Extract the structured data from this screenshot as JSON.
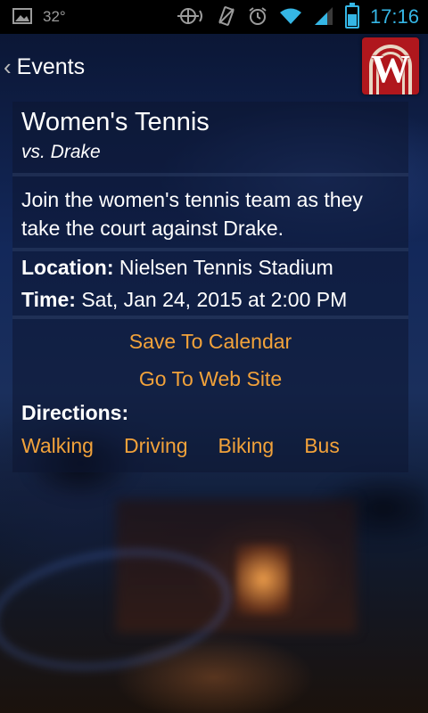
{
  "status_bar": {
    "temperature": "32°",
    "time": "17:16"
  },
  "action_bar": {
    "back_title": "Events",
    "logo_letter": "W"
  },
  "event": {
    "title": "Women's Tennis",
    "opponent": "vs. Drake",
    "description": "Join the women's tennis team as they take the court against Drake.",
    "location_label": "Location:",
    "location_value": "Nielsen Tennis Stadium",
    "time_label": "Time:",
    "time_value": "Sat, Jan 24, 2015 at 2:00 PM"
  },
  "actions": {
    "save_calendar": "Save To Calendar",
    "web_site": "Go To Web Site"
  },
  "directions": {
    "label": "Directions:",
    "options": [
      "Walking",
      "Driving",
      "Biking",
      "Bus"
    ]
  },
  "colors": {
    "accent_orange": "#f2a23a",
    "status_blue": "#35b6e5",
    "logo_red": "#b0171d"
  }
}
